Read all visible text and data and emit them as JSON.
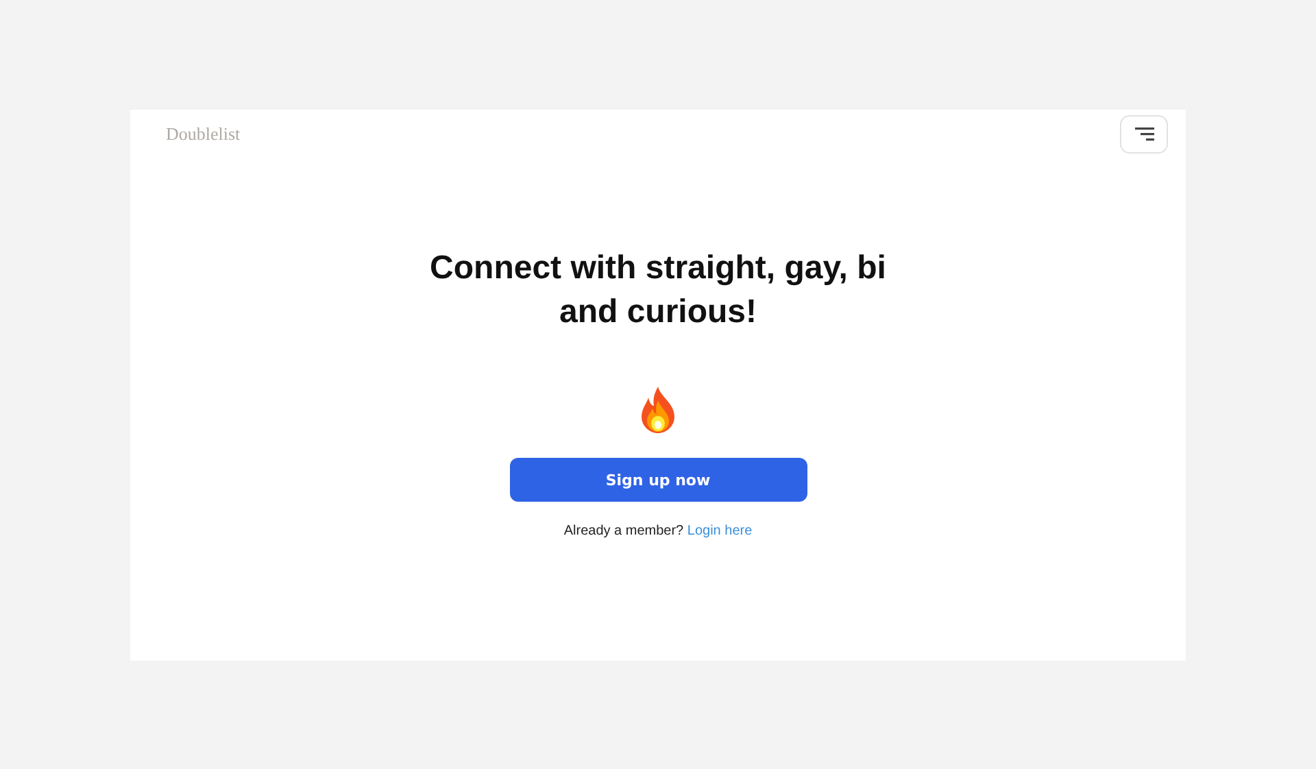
{
  "header": {
    "logo": "Doublelist"
  },
  "hero": {
    "headline": "Connect with straight, gay, bi and curious!",
    "cta": "Sign up now",
    "member_prompt": "Already a member?",
    "login_link": "Login here"
  }
}
